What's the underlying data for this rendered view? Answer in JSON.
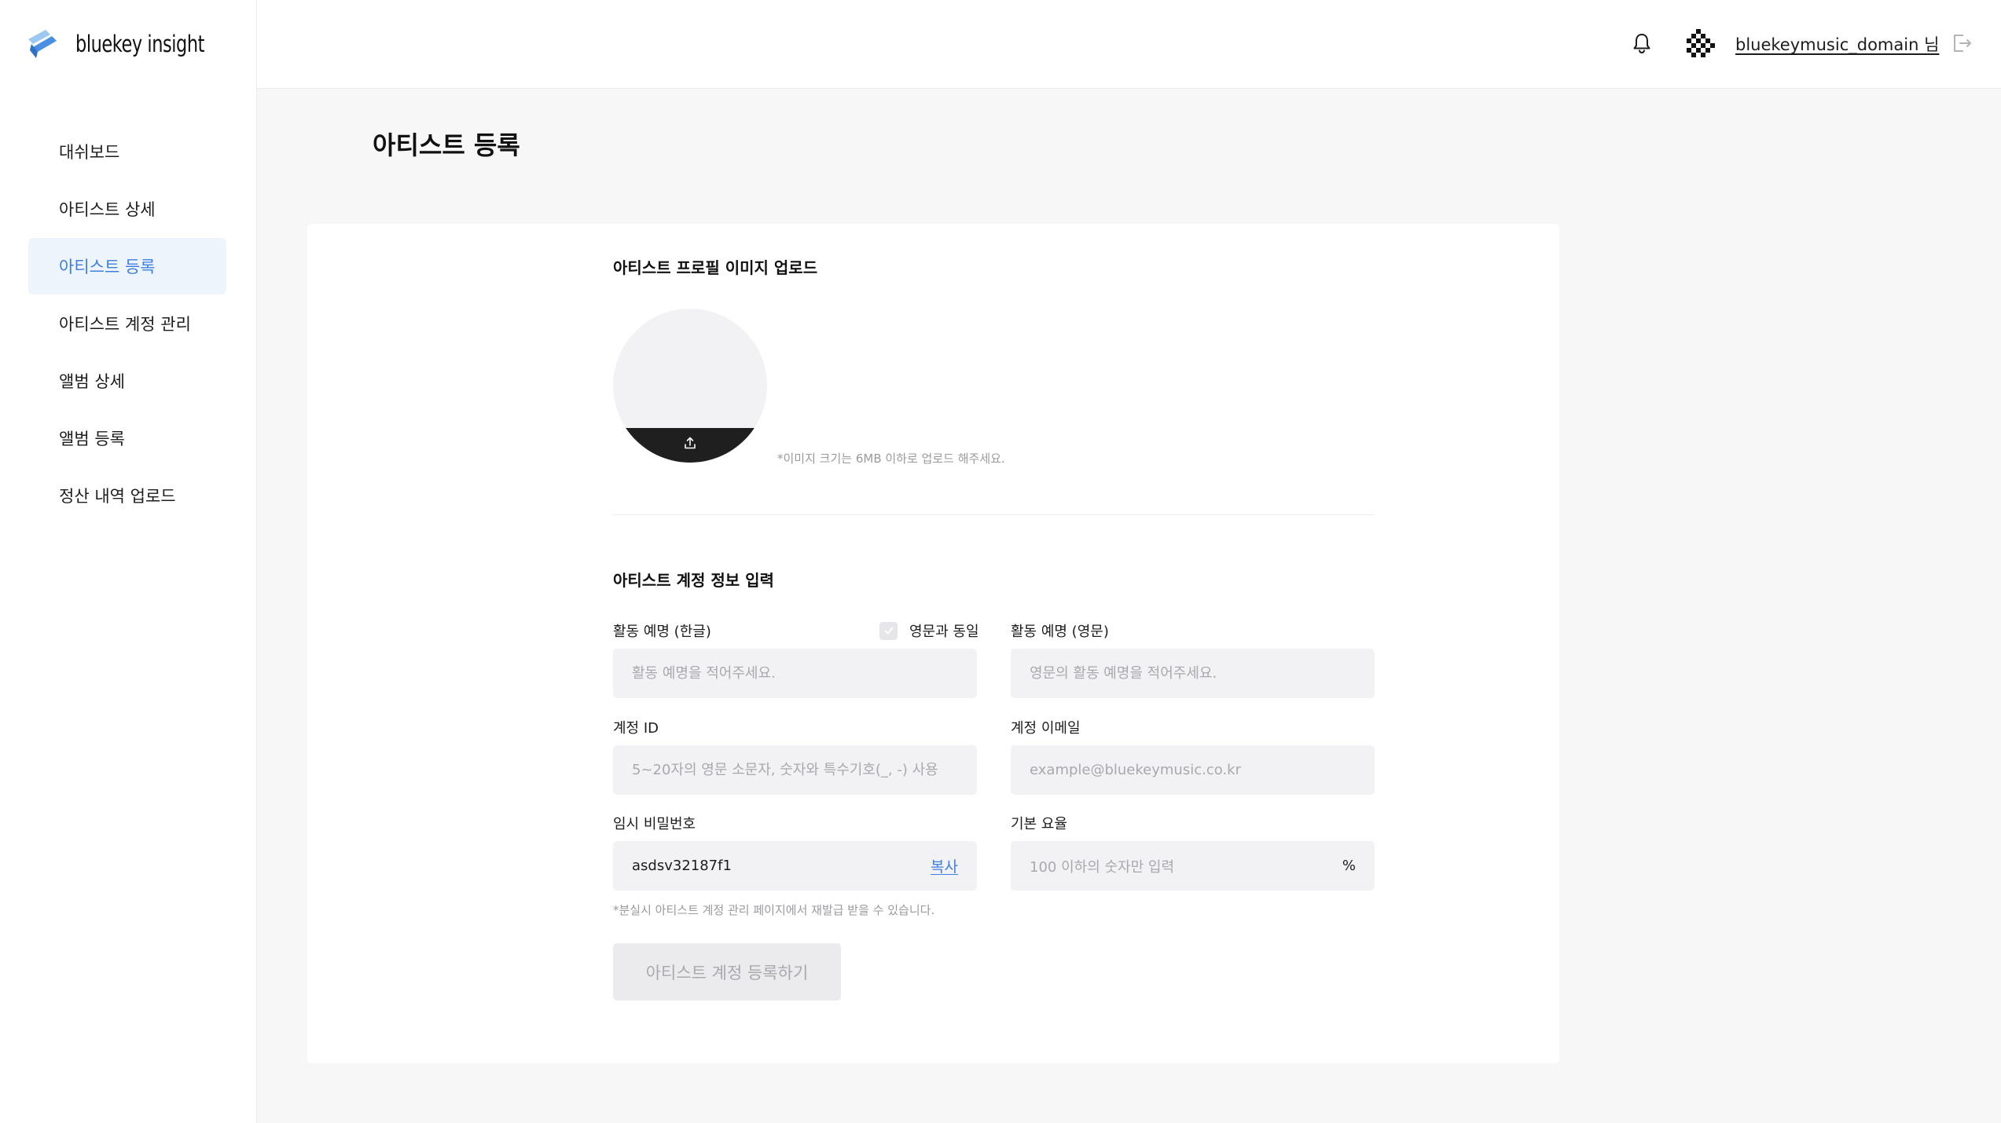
{
  "brand": {
    "name": "bluekey insight",
    "accent": "#3d7fe0"
  },
  "sidebar": {
    "items": [
      {
        "label": "대쉬보드",
        "active": false
      },
      {
        "label": "아티스트 상세",
        "active": false
      },
      {
        "label": "아티스트 등록",
        "active": true
      },
      {
        "label": "아티스트 계정 관리",
        "active": false
      },
      {
        "label": "앨범 상세",
        "active": false
      },
      {
        "label": "앨범 등록",
        "active": false
      },
      {
        "label": "정산 내역 업로드",
        "active": false
      }
    ]
  },
  "header": {
    "user": "bluekeymusic_domain 님",
    "icons": {
      "notification": "bell-icon",
      "logout": "logout-icon"
    }
  },
  "page": {
    "title": "아티스트 등록",
    "profile_section": {
      "title": "아티스트 프로필 이미지 업로드",
      "note": "*이미지 크기는 6MB 이하로 업로드 해주세요.",
      "upload_icon": "upload-icon"
    },
    "account_section": {
      "title": "아티스트 계정 정보 입력",
      "name_ko": {
        "label": "활동 예명 (한글)",
        "placeholder": "활동 예명을 적어주세요.",
        "value": ""
      },
      "same_as_en": {
        "label": "영문과 동일",
        "checked": false
      },
      "name_en": {
        "label": "활동 예명 (영문)",
        "placeholder": "영문의 활동 예명을 적어주세요.",
        "value": ""
      },
      "account_id": {
        "label": "계정 ID",
        "placeholder": "5~20자의 영문 소문자, 숫자와 특수기호(_, -) 사용",
        "value": ""
      },
      "email": {
        "label": "계정 이메일",
        "placeholder": "example@bluekeymusic.co.kr",
        "value": ""
      },
      "temp_password": {
        "label": "임시 비밀번호",
        "value": "asdsv32187f1",
        "copy_label": "복사"
      },
      "base_rate": {
        "label": "기본 요율",
        "placeholder": "100 이하의 숫자만 입력",
        "unit": "%",
        "value": ""
      },
      "help_note": "*분실시 아티스트 계정 관리 페이지에서 재발급 받을 수 있습니다.",
      "submit_label": "아티스트 계정 등록하기",
      "submit_enabled": false
    }
  }
}
